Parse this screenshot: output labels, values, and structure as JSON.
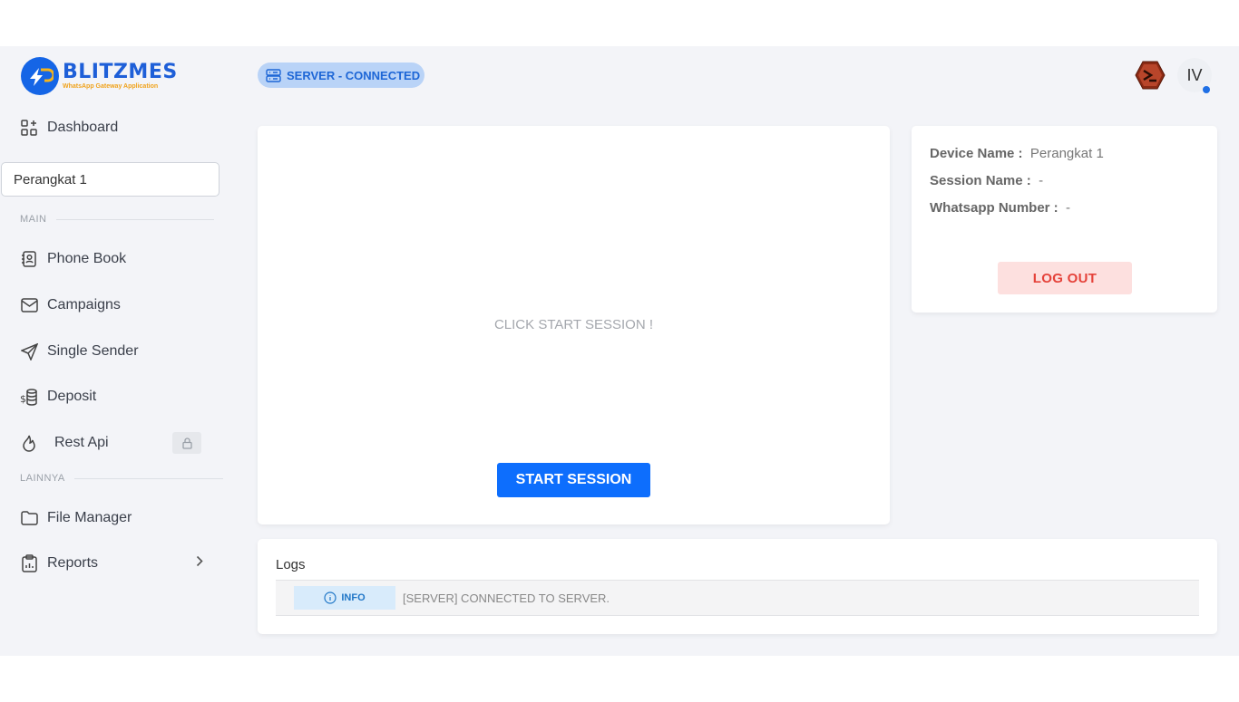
{
  "brand": {
    "title": "BLITZMES",
    "subtitle": "WhatsApp Gateway Application"
  },
  "sidebar": {
    "dashboard": "Dashboard",
    "device_select": "Perangkat 1",
    "section_main": "MAIN",
    "items_main": [
      "Phone Book",
      "Campaigns",
      "Single Sender",
      "Deposit",
      "Rest Api"
    ],
    "section_other": "LAINNYA",
    "items_other": [
      "File Manager",
      "Reports"
    ]
  },
  "header": {
    "server_status": "SERVER - CONNECTED",
    "user_initials": "IV"
  },
  "session": {
    "message": "CLICK START SESSION !",
    "start_label": "START SESSION"
  },
  "device_info": {
    "device_name_label": "Device Name :",
    "device_name_value": "Perangkat 1",
    "session_name_label": "Session Name :",
    "session_name_value": "-",
    "whatsapp_label": "Whatsapp Number :",
    "whatsapp_value": "-",
    "logout_label": "LOG OUT"
  },
  "logs": {
    "title": "Logs",
    "entries": [
      {
        "level": "INFO",
        "message": "[SERVER] CONNECTED TO SERVER."
      }
    ]
  },
  "colors": {
    "accent": "#0d6efd",
    "danger": "#e5423a",
    "background": "#f3f4f8"
  }
}
